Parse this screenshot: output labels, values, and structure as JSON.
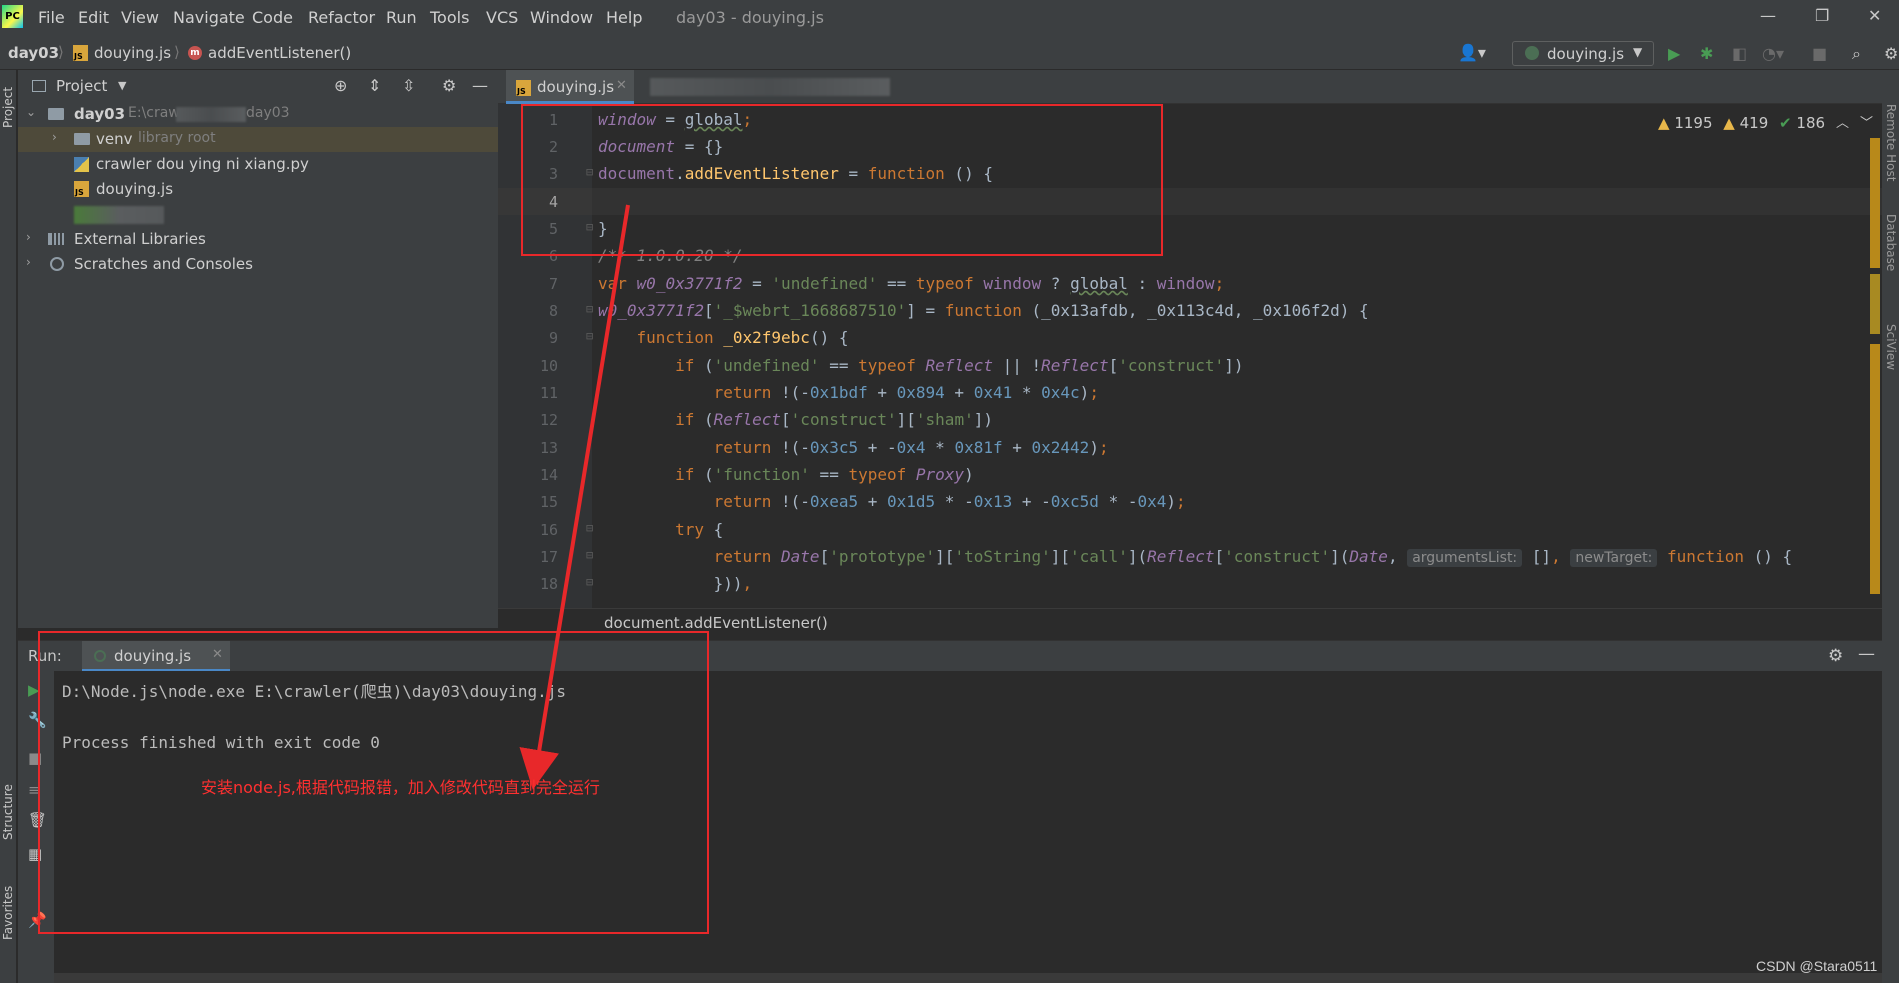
{
  "app": {
    "logo": "PC",
    "window_title": "day03 - douying.js",
    "menu": [
      "File",
      "Edit",
      "View",
      "Navigate",
      "Code",
      "Refactor",
      "Run",
      "Tools",
      "VCS",
      "Window",
      "Help"
    ]
  },
  "navbar": {
    "project": "day03",
    "file": "douying.js",
    "method": "addEventListener()",
    "method_icon": "m",
    "run_config": "douying.js"
  },
  "left_strip": {
    "project": "Project",
    "structure": "Structure",
    "favorites": "Favorites"
  },
  "right_strip": {
    "remote_host": "Remote Host",
    "database": "Database",
    "sciview": "SciView"
  },
  "project_panel": {
    "title": "Project",
    "tree": [
      {
        "label": "day03",
        "hint": "E:\\craw",
        "hint_tail": "day03"
      },
      {
        "label": "venv",
        "hint": "library root"
      },
      {
        "label": "crawler dou ying ni xiang.py"
      },
      {
        "label": "douying.js"
      },
      {
        "label": "External Libraries"
      },
      {
        "label": "Scratches and Consoles"
      }
    ]
  },
  "editor": {
    "tab": "douying.js",
    "inspections": {
      "warnings": "1195",
      "weak_warnings": "419",
      "ok": "186"
    },
    "line_numbers": [
      "1",
      "2",
      "3",
      "4",
      "5",
      "6",
      "7",
      "8",
      "9",
      "10",
      "11",
      "12",
      "13",
      "14",
      "15",
      "16",
      "17",
      "18"
    ],
    "hints": {
      "arguments": "argumentsList:",
      "target": "newTarget:"
    },
    "breadcrumb": "document.addEventListener()"
  },
  "run": {
    "title": "Run:",
    "tab": "douying.js",
    "output": [
      "D:\\Node.js\\node.exe E:\\crawler(爬虫)\\day03\\douying.js",
      "",
      "Process finished with exit code 0"
    ]
  },
  "annotation": "安装node.js,根据代码报错，加入修改代码直到完全运行",
  "watermark": "CSDN @Stara0511",
  "colors": {
    "annotation_red": "#e8282a",
    "keyword": "#cc7832",
    "string": "#6a8759",
    "number": "#6897bb",
    "global_var": "#9876aa",
    "function": "#ffc66d"
  }
}
